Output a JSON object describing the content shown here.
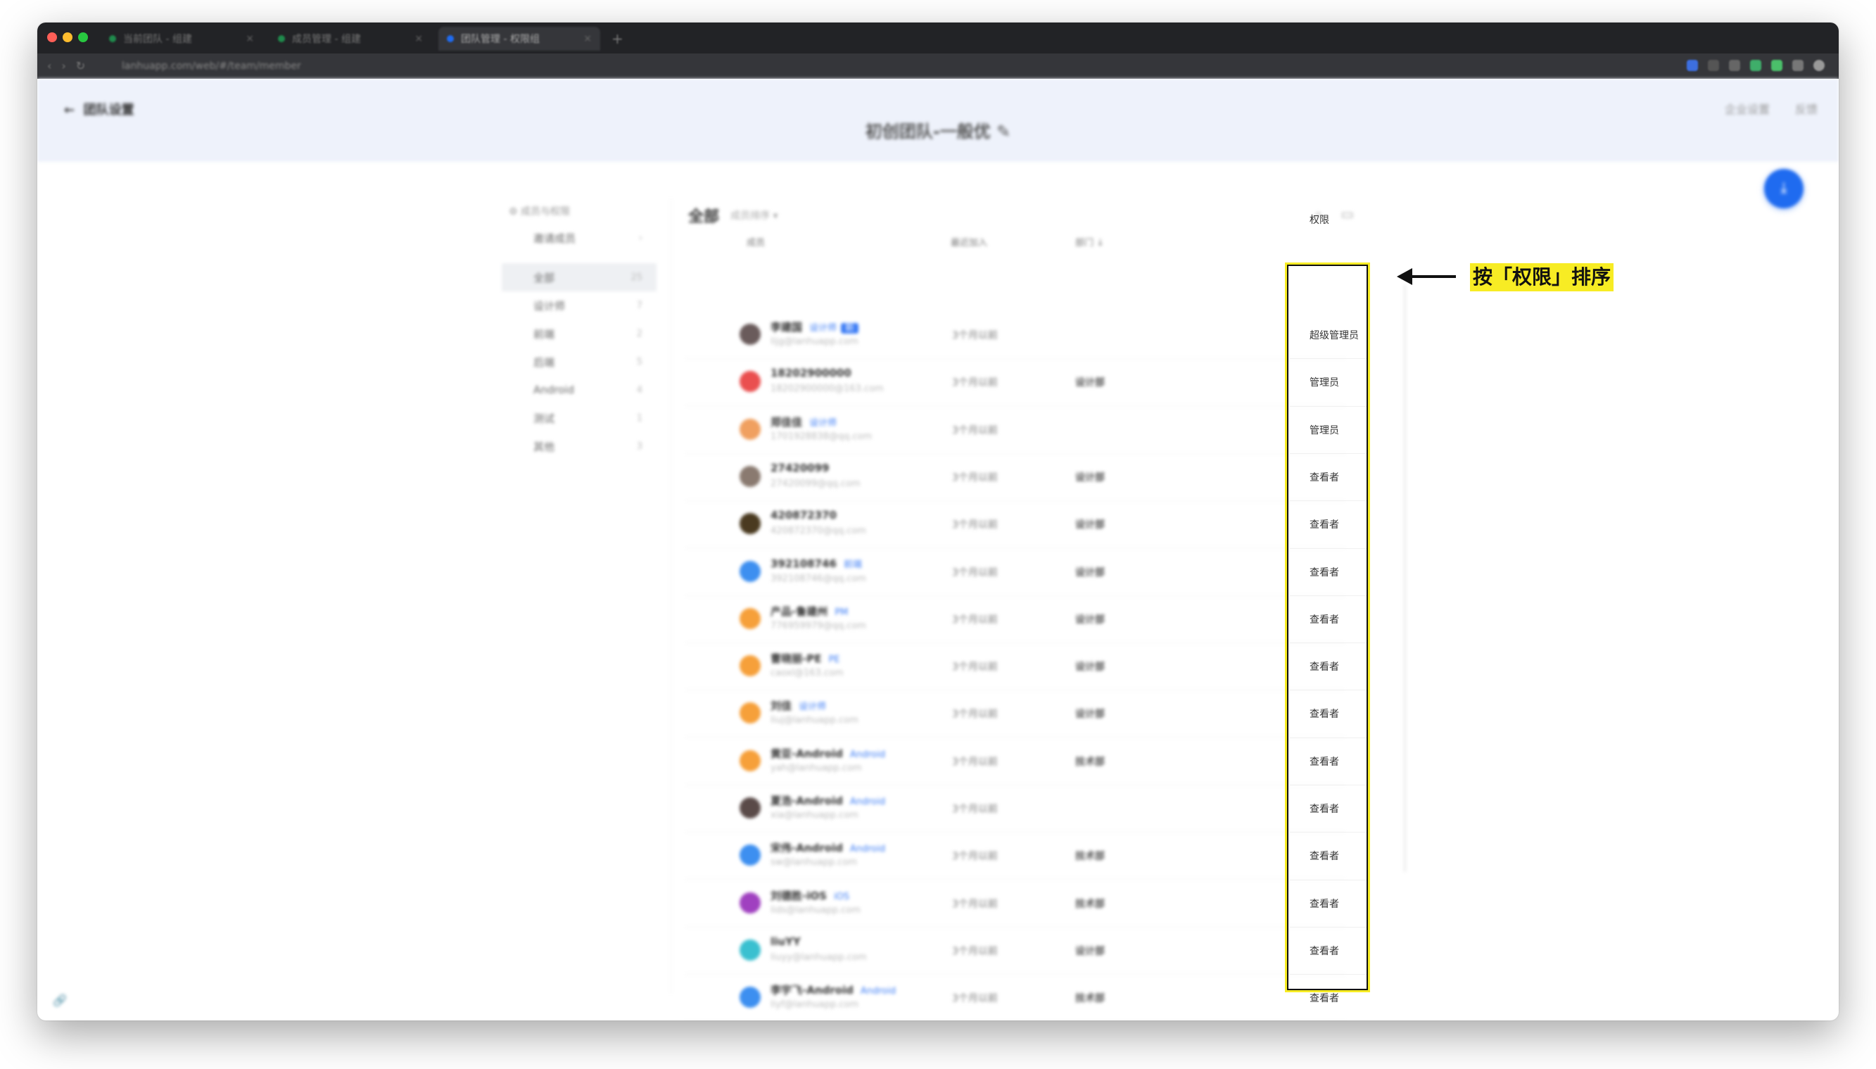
{
  "browser": {
    "tabs": [
      {
        "title": "当前团队 - 组建",
        "dot": "#1f8a4c"
      },
      {
        "title": "成员管理 - 组建",
        "dot": "#1f8a4c"
      },
      {
        "title": "团队管理 - 权限组",
        "dot": "#1f6bf0"
      }
    ],
    "url": "lanhuapp.com/web/#/team/member"
  },
  "header": {
    "back_label": "团队设置",
    "team_name": "初创团队-一般优 ✎",
    "action_1": "企业设置",
    "action_2": "反馈",
    "fab_label": "⤓"
  },
  "sidebar": {
    "title": "⚙ 成员与权限",
    "top_item": {
      "label": "邀请成员",
      "count": "›"
    },
    "items": [
      {
        "label": "全部",
        "count": "25"
      },
      {
        "label": "设计师",
        "count": "7"
      },
      {
        "label": "前端",
        "count": "2"
      },
      {
        "label": "后端",
        "count": "5"
      },
      {
        "label": "Android",
        "count": "4"
      },
      {
        "label": "测试",
        "count": "1"
      },
      {
        "label": "其他",
        "count": "3"
      }
    ]
  },
  "main": {
    "title": "全部",
    "subtitle": "成员排序 ▾",
    "col_name": "成员",
    "col_join": "最近加入",
    "col_group": "部门 ↓",
    "col_perm": "权限"
  },
  "rows": [
    {
      "name": "李建国",
      "tag": "设计师",
      "badge": "新",
      "email": "lijg@lanhuapp.com",
      "joined": "3个月以前",
      "group": "",
      "perm": "超级管理员",
      "avatar": "#6a5b5b"
    },
    {
      "name": "18202900000",
      "tag": "",
      "badge": "",
      "email": "18202900000@163.com",
      "joined": "3个月以前",
      "group": "设计部",
      "perm": "管理员",
      "avatar": "#ea4f4f"
    },
    {
      "name": "郑佳佳",
      "tag": "设计师",
      "badge": "",
      "email": "1701928838@qq.com",
      "joined": "3个月以前",
      "group": "",
      "perm": "管理员",
      "avatar": "#f0a060"
    },
    {
      "name": "27420099",
      "tag": "",
      "badge": "",
      "email": "27420099@qq.com",
      "joined": "3个月以前",
      "group": "设计部",
      "perm": "查看者",
      "avatar": "#8a7a70"
    },
    {
      "name": "420872370",
      "tag": "",
      "badge": "",
      "email": "420872370@qq.com",
      "joined": "3个月以前",
      "group": "设计部",
      "perm": "查看者",
      "avatar": "#4a3a20"
    },
    {
      "name": "392108746",
      "tag": "前端",
      "badge": "",
      "email": "392108746@qq.com",
      "joined": "3个月以前",
      "group": "设计部",
      "perm": "查看者",
      "avatar": "#3d8ff0"
    },
    {
      "name": "产品-鲁建州",
      "tag": "PM",
      "badge": "",
      "email": "776959979@qq.com",
      "joined": "3个月以前",
      "group": "设计部",
      "perm": "查看者",
      "avatar": "#f6a03a"
    },
    {
      "name": "曹晓丽-PE",
      "tag": "PE",
      "badge": "",
      "email": "caoxl@163.com",
      "joined": "3个月以前",
      "group": "设计部",
      "perm": "查看者",
      "avatar": "#f6a03a"
    },
    {
      "name": "刘佳",
      "tag": "设计师",
      "badge": "",
      "email": "liuj@lanhuapp.com",
      "joined": "3个月以前",
      "group": "设计部",
      "perm": "查看者",
      "avatar": "#f6a03a"
    },
    {
      "name": "黄亚-Android",
      "tag": "Android",
      "badge": "",
      "email": "yah@lanhuapp.com",
      "joined": "3个月以前",
      "group": "技术部",
      "perm": "查看者",
      "avatar": "#f6a03a"
    },
    {
      "name": "夏浩-Android",
      "tag": "Android",
      "badge": "",
      "email": "xia@lanhuapp.com",
      "joined": "3个月以前",
      "group": "",
      "perm": "查看者",
      "avatar": "#5a4a48"
    },
    {
      "name": "宋伟-Android",
      "tag": "Android",
      "badge": "",
      "email": "sw@lanhuapp.com",
      "joined": "3个月以前",
      "group": "技术部",
      "perm": "查看者",
      "avatar": "#3d8ff0"
    },
    {
      "name": "刘德胜-iOS",
      "tag": "iOS",
      "badge": "",
      "email": "lids@lanhuapp.com",
      "joined": "3个月以前",
      "group": "技术部",
      "perm": "查看者",
      "avatar": "#a040c0"
    },
    {
      "name": "liuYY",
      "tag": "",
      "badge": "",
      "email": "liuyy@lanhuapp.com",
      "joined": "3个月以前",
      "group": "设计部",
      "perm": "查看者",
      "avatar": "#3ac0d0"
    },
    {
      "name": "李宇飞-Android",
      "tag": "Android",
      "badge": "",
      "email": "liyf@lanhuapp.com",
      "joined": "3个月以前",
      "group": "技术部",
      "perm": "查看者",
      "avatar": "#3d8ff0"
    }
  ],
  "annotation": {
    "text": "按「权限」排序",
    "highlight_color": "#f7ec24"
  }
}
